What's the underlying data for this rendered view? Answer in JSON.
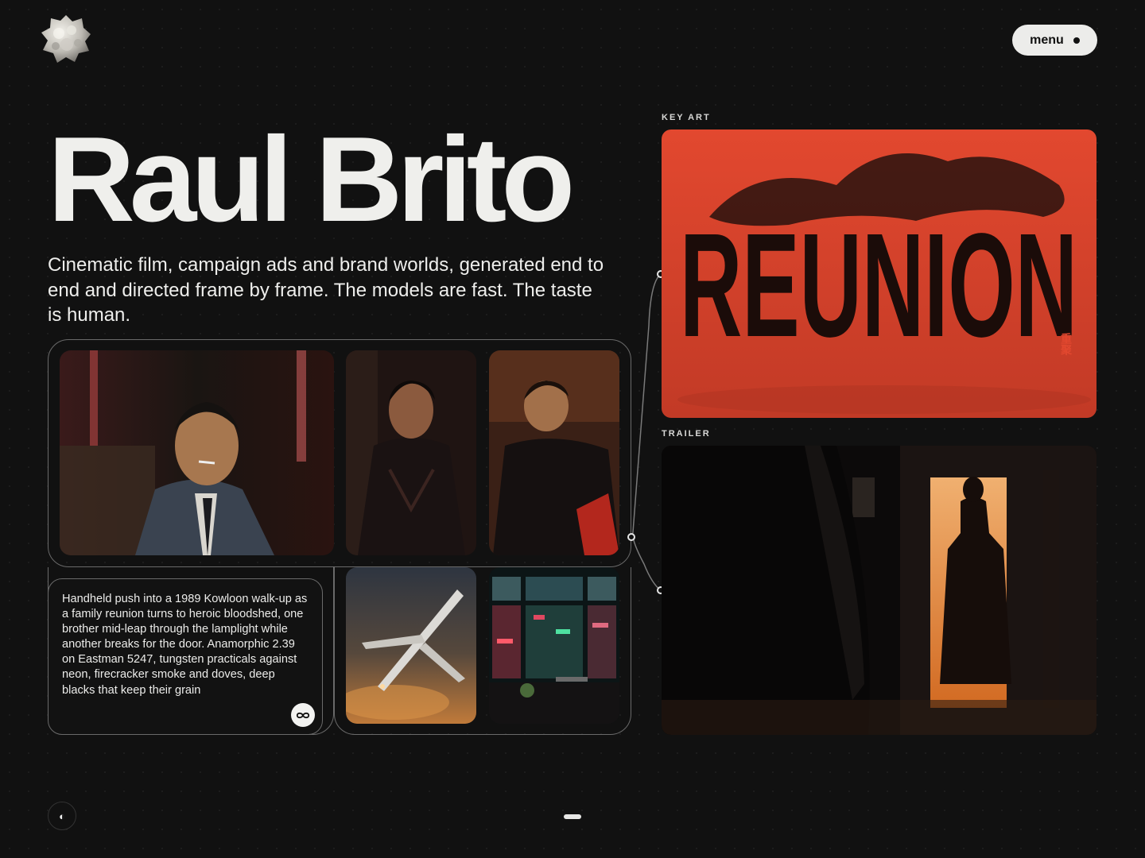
{
  "header": {
    "menu_label": "menu",
    "logo_icon": "sculpted-blob-logo-icon"
  },
  "hero": {
    "title": "Raul Brito",
    "subtitle": "Cinematic film, campaign ads and brand worlds, generated end to end and directed frame by frame. The models are fast. The taste is human."
  },
  "gallery": {
    "caption": "Handheld push into a 1989 Kowloon walk-up as a family reunion turns to heroic bloodshed, one brother mid-leap through the lamplight while another breaks for the door. Anamorphic 2.39 on Eastman 5247, tungsten practicals against neon, firecracker smoke and doves, deep blacks that keep their grain",
    "loop_icon": "infinity-icon",
    "images": [
      {
        "name": "man-smoking-in-suit-still"
      },
      {
        "name": "young-man-leather-jacket-still"
      },
      {
        "name": "man-looking-up-still"
      },
      {
        "name": "airplane-in-sunset-still"
      },
      {
        "name": "neon-window-still"
      }
    ]
  },
  "right": {
    "key_art_label": "KEY ART",
    "key_art_title": "REUNION",
    "key_art_cjk": "重聚",
    "trailer_label": "TRAILER"
  },
  "footer": {
    "theme_icon": "contrast-icon",
    "theme_glyph": "◐"
  },
  "colors": {
    "background": "#111111",
    "key_art_red": "#e0442c",
    "pill": "#ececea"
  }
}
